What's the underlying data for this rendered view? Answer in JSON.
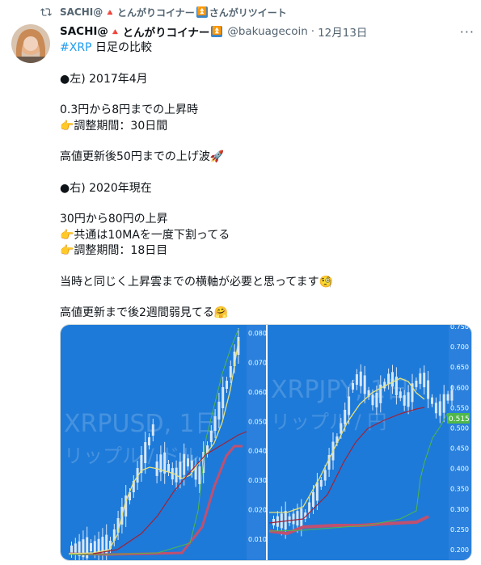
{
  "retweet": {
    "user": "SACHI@",
    "emoji1": "🔺",
    "name_part": "とんがりコイナー",
    "emoji2": "⏫",
    "suffix": "さんがリツイート"
  },
  "tweet": {
    "display_name": "SACHI@",
    "name_emoji1": "🔺",
    "name_part": "とんがりコイナー",
    "name_emoji2": "⏫",
    "handle": "@bakuagecoin",
    "separator": "·",
    "date": "12月13日",
    "more": "···",
    "hashtag": "#XRP",
    "line1_rest": " 日足の比較",
    "line2": "●左) 2017年4月",
    "line3": "0.3円から8円までの上昇時",
    "line4": "👉調整期間：30日間",
    "line5": "高値更新後50円までの上げ波🚀",
    "line6": "●右) 2020年現在",
    "line7": "30円から80円の上昇",
    "line8": "👉共通は10MAを一度下割ってる",
    "line9": "👉調整期間：18日目",
    "line10": "当時と同じく上昇雲までの横軸が必要と思ってます🧐",
    "line11": "高値更新まで後2週間弱見てる🤗"
  },
  "media": {
    "left_chart": {
      "watermark_line1": "XRPUSD, 1日",
      "watermark_line2": "リップル / ドル",
      "y_ticks": [
        "0.080",
        "0.070",
        "0.060",
        "0.050",
        "0.040",
        "0.030",
        "0.020",
        "0.010"
      ]
    },
    "right_chart": {
      "watermark_line1": "XRPJPY, 1日",
      "watermark_line2": "リップル / 円",
      "price_badge": "0.515",
      "y_ticks": [
        "0.750",
        "0.700",
        "0.650",
        "0.600",
        "0.550",
        "0.500",
        "0.450",
        "0.400",
        "0.350",
        "0.300",
        "0.250",
        "0.200"
      ]
    },
    "colors": {
      "chart_bg": "#1e7ad8",
      "axis_bg": "#2a80dc",
      "candle": "#d7e6f7",
      "ma_yellow": "#e8e27a",
      "ma_red": "#a02238",
      "cloud": "#c05070",
      "green_line": "#4fb848"
    }
  }
}
